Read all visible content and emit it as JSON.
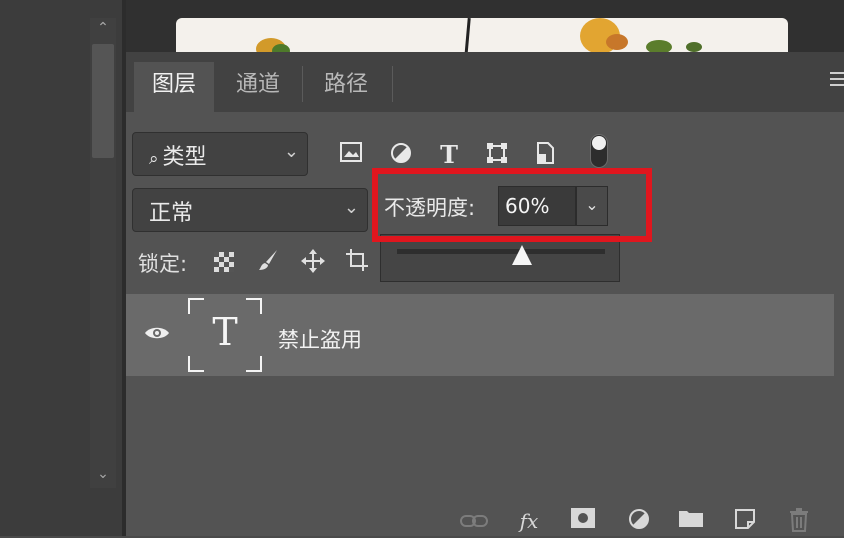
{
  "tabs": [
    {
      "label": "图层",
      "active": true
    },
    {
      "label": "通道",
      "active": false
    },
    {
      "label": "路径",
      "active": false
    }
  ],
  "filter": {
    "label": "类型",
    "search_icon": "search-icon",
    "chevron": "⌄"
  },
  "filter_icons": [
    "image-icon",
    "adjustment-icon",
    "type-icon",
    "shape-icon",
    "smart-object-icon"
  ],
  "blend": {
    "value": "正常",
    "chevron": "⌄"
  },
  "opacity": {
    "label": "不透明度:",
    "value": "60%",
    "chevron": "⌄",
    "slider_fraction": 0.6
  },
  "lock": {
    "label": "锁定:"
  },
  "layer": {
    "name": "禁止盗用",
    "thumb_glyph": "T",
    "visible": true
  },
  "footer_icons": [
    "link-icon",
    "fx-icon",
    "mask-icon",
    "adjustment-layer-icon",
    "group-icon",
    "new-layer-icon",
    "trash-icon"
  ],
  "scroll": {
    "up": "⌃",
    "down": "⌄"
  },
  "colors": {
    "highlight": "#e0161e",
    "panel": "#535353",
    "selected_row": "#6a6a6a"
  }
}
